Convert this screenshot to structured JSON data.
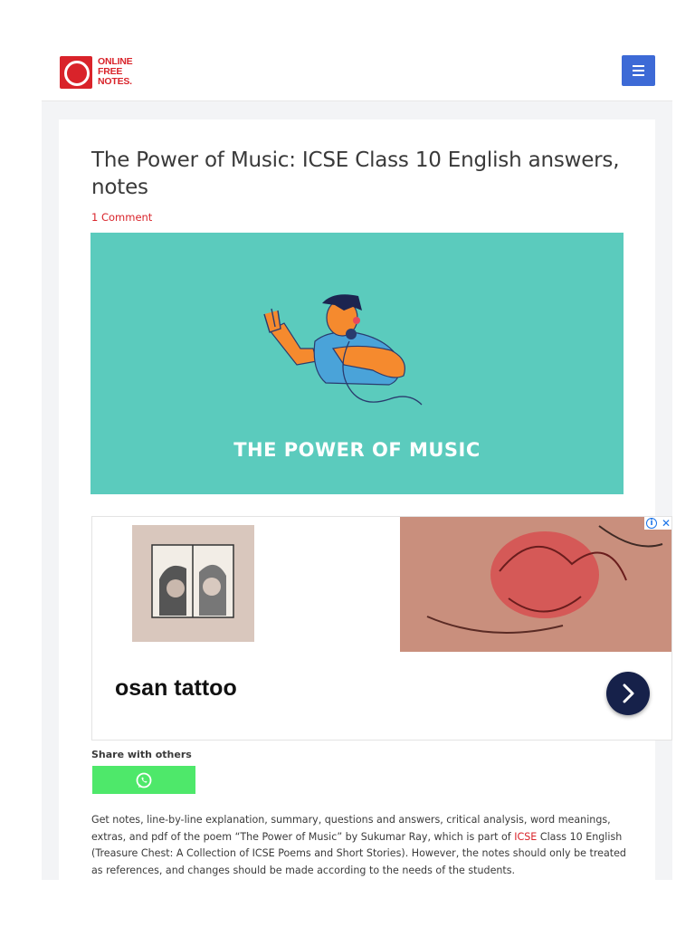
{
  "header": {
    "logo_line1": "ONLINE",
    "logo_line2": "FREE",
    "logo_line3": "NOTES.",
    "menu_icon": "hamburger-menu-icon"
  },
  "post": {
    "title": "The Power of Music: ICSE Class 10 English answers, notes",
    "comments": "1 Comment",
    "featured_caption": "THE POWER OF MUSIC"
  },
  "ad": {
    "headline": "osan tattoo",
    "info_icon": "ad-choices-icon",
    "close_icon": "close-icon",
    "next_icon": "chevron-right-icon"
  },
  "share": {
    "label": "Share with others",
    "whatsapp_icon": "whatsapp-icon"
  },
  "intro": {
    "text_before": "Get notes, line-by-line explanation, summary, questions and answers, critical analysis, word meanings, extras, and pdf of the poem “The Power of Music” by Sukumar Ray, which is part of ",
    "link": "ICSE",
    "text_after": " Class 10 English (Treasure Chest: A Collection of ICSE Poems and Short Stories). However, the notes should only be treated as references, and changes should be made according to the needs of the students."
  },
  "colors": {
    "brand_red": "#d9232a",
    "menu_blue": "#3d6ad6",
    "featured_bg": "#5bcbbd",
    "whatsapp_green": "#4ee86a",
    "ad_next_bg": "#16214a"
  }
}
